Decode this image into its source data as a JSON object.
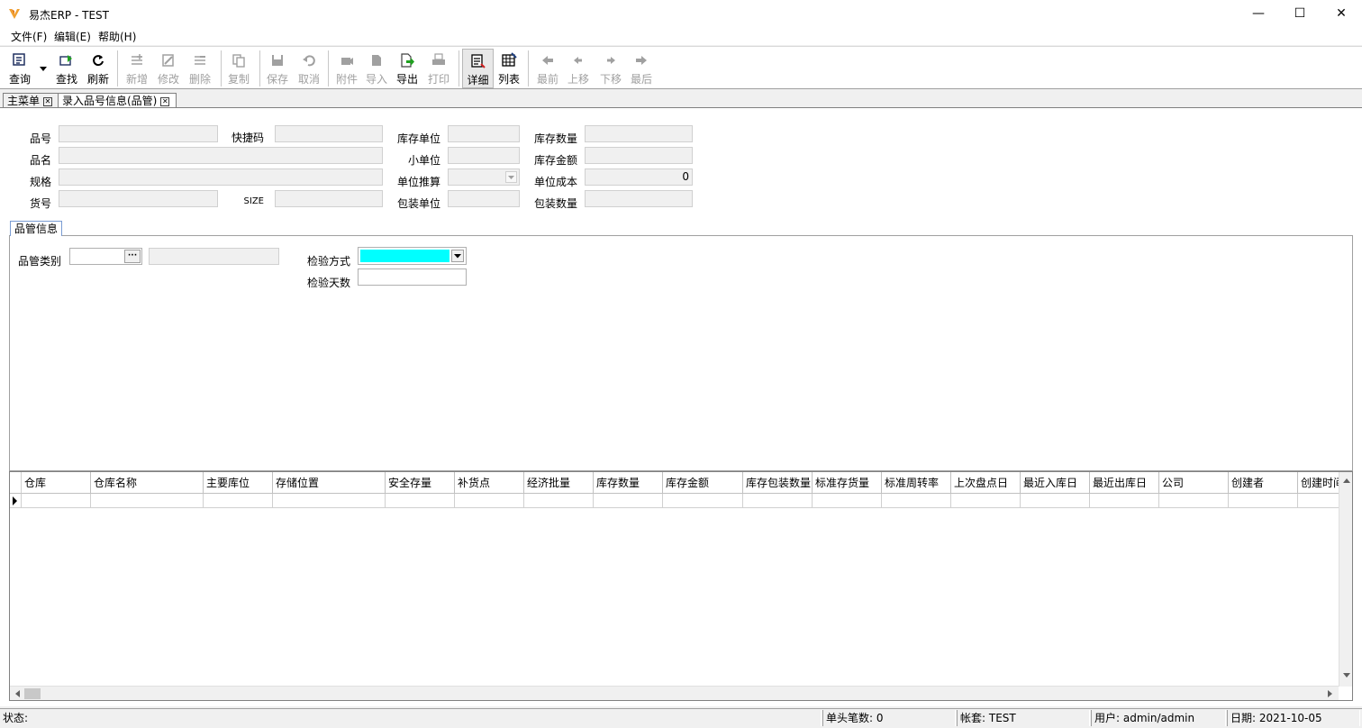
{
  "window": {
    "title": "易杰ERP - TEST",
    "minimize": "—",
    "maximize": "☐",
    "close": "✕"
  },
  "menu": [
    "文件(F)",
    "编辑(E)",
    "帮助(H)"
  ],
  "toolbar": {
    "query": "查询",
    "find": "查找",
    "refresh": "刷新",
    "add": "新增",
    "edit": "修改",
    "delete": "删除",
    "copy": "复制",
    "save": "保存",
    "cancel": "取消",
    "attach": "附件",
    "import": "导入",
    "export": "导出",
    "print": "打印",
    "detail": "详细",
    "list": "列表",
    "first": "最前",
    "prev": "上移",
    "next": "下移",
    "last": "最后"
  },
  "tabs": [
    {
      "label": "主菜单",
      "close": "✕"
    },
    {
      "label": "录入品号信息(品管)",
      "close": "✕"
    }
  ],
  "form": {
    "item_no": "品号",
    "shortcut": "快捷码",
    "stock_unit": "库存单位",
    "stock_qty": "库存数量",
    "item_name": "品名",
    "small_unit": "小单位",
    "stock_amount": "库存金额",
    "spec": "规格",
    "unit_calc": "单位推算",
    "unit_cost": "单位成本",
    "unit_cost_value": "0",
    "goods_no": "货号",
    "size": "SIZE",
    "pack_unit": "包装单位",
    "pack_qty": "包装数量"
  },
  "qc": {
    "tab": "品管信息",
    "category": "品管类别",
    "category_btn": "···",
    "inspect_method": "检验方式",
    "inspect_days": "检验天数",
    "inspect_method_color": "#00ffff"
  },
  "grid": {
    "columns": [
      "仓库",
      "仓库名称",
      "主要库位",
      "存储位置",
      "安全存量",
      "补货点",
      "经济批量",
      "库存数量",
      "库存金额",
      "库存包装数量",
      "标准存货量",
      "标准周转率",
      "上次盘点日",
      "最近入库日",
      "最近出库日",
      "公司",
      "创建者",
      "创建时间"
    ]
  },
  "status": {
    "state": "状态:",
    "count": "单头笔数: 0",
    "account": "帐套: TEST",
    "user": "用户: admin/admin",
    "date": "日期: 2021-10-05"
  }
}
